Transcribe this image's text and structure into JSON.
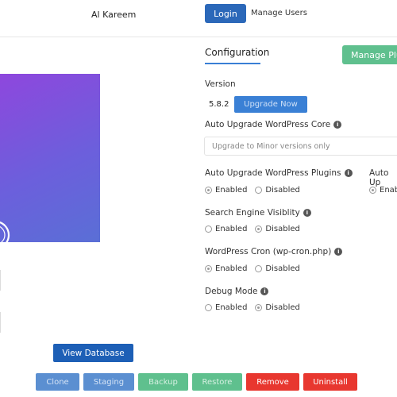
{
  "header": {
    "user_name": "Al Kareem",
    "login_label": "Login",
    "manage_users_label": "Manage Users"
  },
  "config": {
    "title": "Configuration",
    "manage_plugins_label": "Manage Plu",
    "version_label": "Version",
    "version_value": "5.8.2",
    "upgrade_now_label": "Upgrade Now",
    "auto_core_label": "Auto Upgrade WordPress Core",
    "auto_core_placeholder": "Upgrade to Minor versions only",
    "auto_plugins_label": "Auto Upgrade WordPress Plugins",
    "auto_plugins_value": "Enabled",
    "auto_themes_label_partial": "Auto Up",
    "auto_themes_value_partial": "Enab",
    "search_visibility_label": "Search Engine Visiblity",
    "search_visibility_value": "Disabled",
    "cron_label": "WordPress Cron (wp-cron.php)",
    "cron_value": "Enabled",
    "debug_label": "Debug Mode",
    "debug_value": "Disabled",
    "enabled_text": "Enabled",
    "disabled_text": "Disabled"
  },
  "actions": {
    "view_database": "View Database",
    "clone": "Clone",
    "staging": "Staging",
    "backup": "Backup",
    "restore": "Restore",
    "remove": "Remove",
    "uninstall": "Uninstall"
  },
  "colors": {
    "primary_blue": "#2b68b9",
    "faded_blue": "#5b8fd1",
    "green": "#5fc08e",
    "red": "#e8372f",
    "thumbnail_gradient_start": "#8e47dd",
    "thumbnail_gradient_end": "#5a6fd6"
  },
  "icons": {
    "info": "info-circle-icon",
    "wp_logo": "wordpress-logo-icon"
  }
}
